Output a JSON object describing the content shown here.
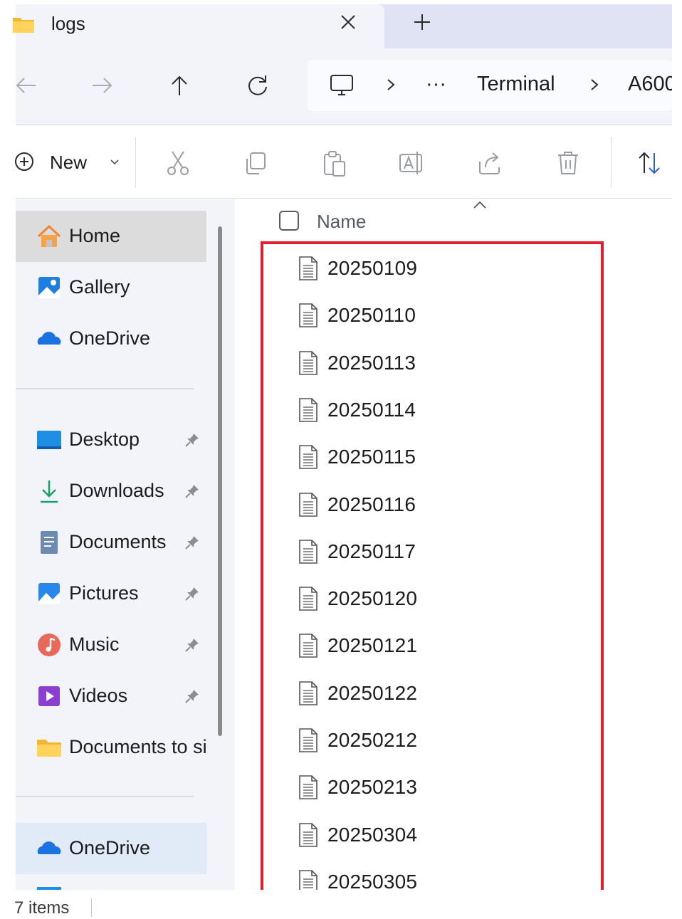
{
  "window": {
    "tab_title": "logs"
  },
  "address": {
    "ellipsis": "···",
    "crumbs": [
      "Terminal",
      "A600"
    ]
  },
  "toolbar": {
    "new_label": "New"
  },
  "sidebar": {
    "items": [
      {
        "label": "Home",
        "icon": "home-icon"
      },
      {
        "label": "Gallery",
        "icon": "gallery-icon"
      },
      {
        "label": "OneDrive",
        "icon": "onedrive-icon"
      },
      {
        "label": "Desktop",
        "icon": "desktop-icon",
        "pinned": true
      },
      {
        "label": "Downloads",
        "icon": "download-icon",
        "pinned": true
      },
      {
        "label": "Documents",
        "icon": "documents-icon",
        "pinned": true
      },
      {
        "label": "Pictures",
        "icon": "pictures-icon",
        "pinned": true
      },
      {
        "label": "Music",
        "icon": "music-icon",
        "pinned": true
      },
      {
        "label": "Videos",
        "icon": "videos-icon",
        "pinned": true
      },
      {
        "label": "Documents to si",
        "icon": "folder-icon"
      },
      {
        "label": "OneDrive",
        "icon": "onedrive-icon"
      }
    ]
  },
  "filelist": {
    "column_name": "Name",
    "files": [
      "20250109",
      "20250110",
      "20250113",
      "20250114",
      "20250115",
      "20250116",
      "20250117",
      "20250120",
      "20250121",
      "20250122",
      "20250212",
      "20250213",
      "20250304",
      "20250305"
    ]
  },
  "status": {
    "item_count": "7 items"
  },
  "colors": {
    "highlight_border": "#e41e2b",
    "chrome_background": "#f3f4fa",
    "tab_strip": "#dfe3f3",
    "selected_nav": "#e1ebf8",
    "active_nav": "#dcdcdc"
  }
}
